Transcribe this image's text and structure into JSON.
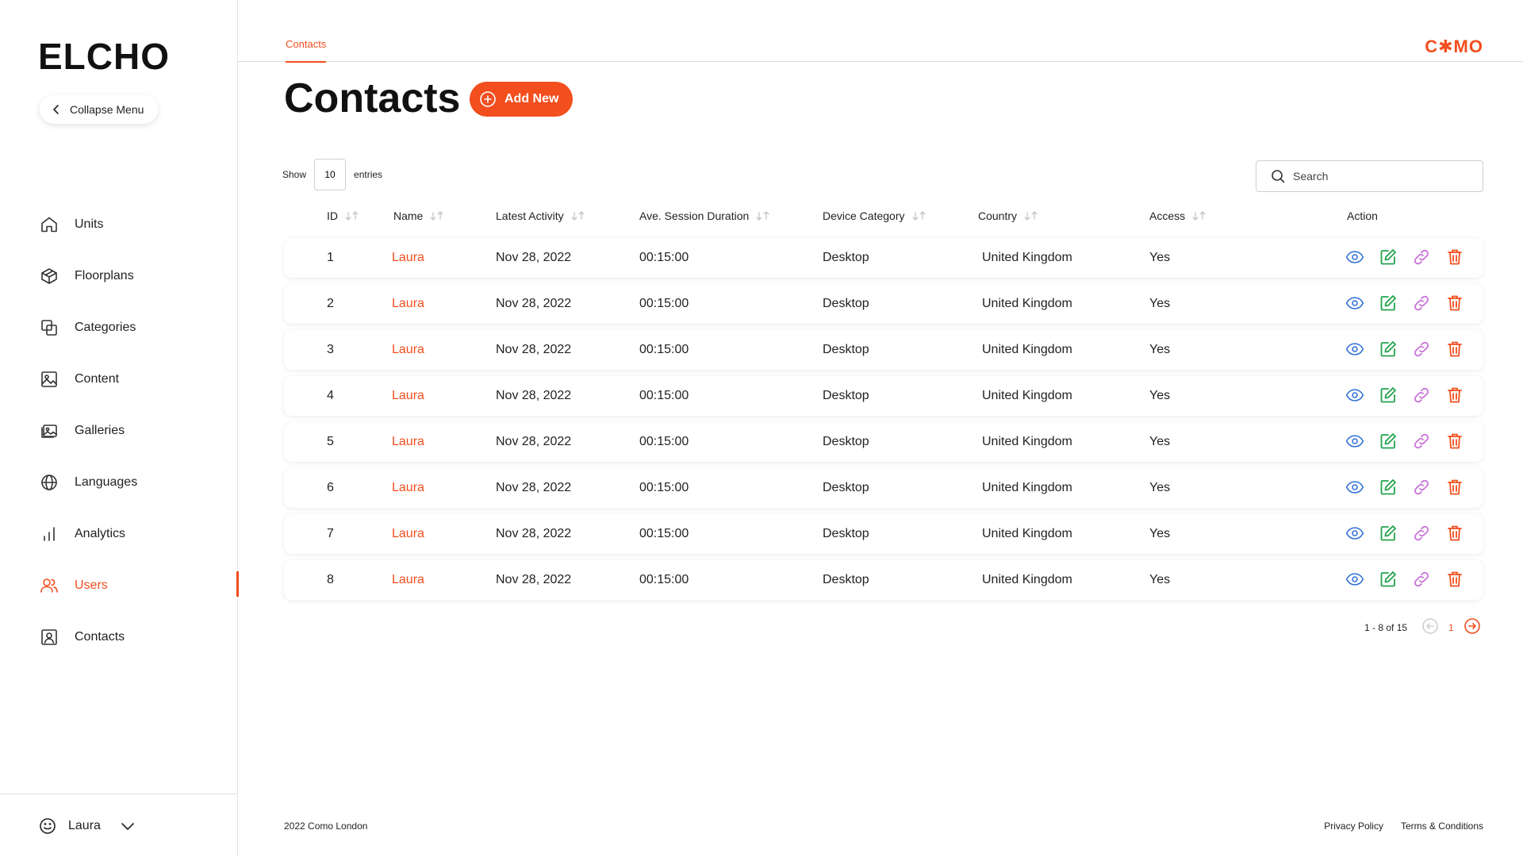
{
  "sidebar": {
    "logo": "ELCHO",
    "collapse_label": "Collapse Menu",
    "items": [
      {
        "label": "Units",
        "icon": "home-icon"
      },
      {
        "label": "Floorplans",
        "icon": "cube-icon"
      },
      {
        "label": "Categories",
        "icon": "copy-icon"
      },
      {
        "label": "Content",
        "icon": "image-icon"
      },
      {
        "label": "Galleries",
        "icon": "gallery-icon"
      },
      {
        "label": "Languages",
        "icon": "globe-icon"
      },
      {
        "label": "Analytics",
        "icon": "bar-chart-icon"
      },
      {
        "label": "Users",
        "icon": "users-icon",
        "active": true
      },
      {
        "label": "Contacts",
        "icon": "contact-icon"
      }
    ],
    "user": {
      "name": "Laura",
      "icon": "smiley-icon"
    }
  },
  "topbar": {
    "tab_label": "Contacts",
    "brand": "C✱MO"
  },
  "main": {
    "title": "Contacts",
    "add_button": "Add New",
    "show_label": "Show",
    "entries_value": "10",
    "entries_label": "entries",
    "search_placeholder": "Search"
  },
  "table": {
    "columns": [
      "ID",
      "Name",
      "Latest Activity",
      "Ave. Session Duration",
      "Device Category",
      "Country",
      "Access",
      "Action"
    ],
    "rows": [
      {
        "id": "1",
        "name": "Laura",
        "activity": "Nov 28, 2022",
        "duration": "00:15:00",
        "device": "Desktop",
        "country": "United Kingdom",
        "access": "Yes"
      },
      {
        "id": "2",
        "name": "Laura",
        "activity": "Nov 28, 2022",
        "duration": "00:15:00",
        "device": "Desktop",
        "country": "United Kingdom",
        "access": "Yes"
      },
      {
        "id": "3",
        "name": "Laura",
        "activity": "Nov 28, 2022",
        "duration": "00:15:00",
        "device": "Desktop",
        "country": "United Kingdom",
        "access": "Yes"
      },
      {
        "id": "4",
        "name": "Laura",
        "activity": "Nov 28, 2022",
        "duration": "00:15:00",
        "device": "Desktop",
        "country": "United Kingdom",
        "access": "Yes"
      },
      {
        "id": "5",
        "name": "Laura",
        "activity": "Nov 28, 2022",
        "duration": "00:15:00",
        "device": "Desktop",
        "country": "United Kingdom",
        "access": "Yes"
      },
      {
        "id": "6",
        "name": "Laura",
        "activity": "Nov 28, 2022",
        "duration": "00:15:00",
        "device": "Desktop",
        "country": "United Kingdom",
        "access": "Yes"
      },
      {
        "id": "7",
        "name": "Laura",
        "activity": "Nov 28, 2022",
        "duration": "00:15:00",
        "device": "Desktop",
        "country": "United Kingdom",
        "access": "Yes"
      },
      {
        "id": "8",
        "name": "Laura",
        "activity": "Nov 28, 2022",
        "duration": "00:15:00",
        "device": "Desktop",
        "country": "United Kingdom",
        "access": "Yes"
      }
    ],
    "action_icons": [
      "eye-icon",
      "edit-icon",
      "link-icon",
      "trash-icon"
    ]
  },
  "pagination": {
    "range": "1 - 8 of 15",
    "current_page": "1"
  },
  "footer": {
    "copyright": "2022 Como London",
    "privacy": "Privacy Policy",
    "terms": "Terms & Conditions"
  },
  "colors": {
    "accent": "#f24e1e",
    "view": "#2f6fd6",
    "edit": "#23a24d",
    "link": "#c774d9"
  }
}
